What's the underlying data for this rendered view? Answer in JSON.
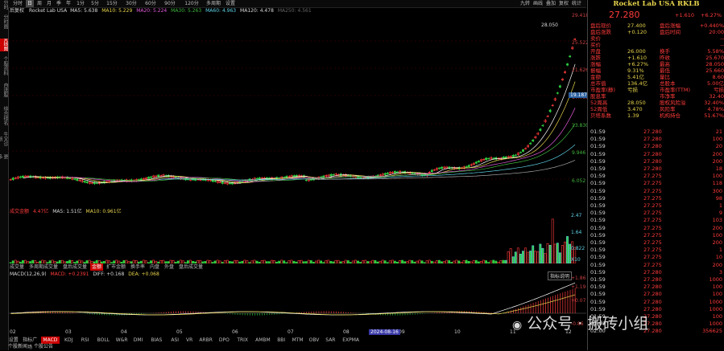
{
  "left_tabs": [
    "分时",
    "分时图",
    "K线图",
    "个股资料",
    "自选股",
    "综合排名",
    "牛叉诊断",
    "更多"
  ],
  "toolbar": {
    "items": [
      "分时",
      "日",
      "周",
      "月",
      "季",
      "年",
      "1分",
      "5分",
      "15分",
      "30分",
      "60分",
      "90分",
      "120分",
      "多周期",
      "设置"
    ],
    "active_index": 1,
    "right_items": [
      "九转",
      "画线",
      "叠加",
      "复权",
      "统计"
    ]
  },
  "main_legend": {
    "title": "后复权",
    "name": "Rocket Lab USA",
    "ma5": "MA5: 5.638",
    "ma10": "MA10: 5.229",
    "ma20": "MA20: 5.224",
    "ma30": "MA30: 5.263",
    "ma60": "MA60: 4.963",
    "ma120": "MA120: 4.478",
    "ma250": "MA250: 4.561"
  },
  "price_axis": [
    "29.418",
    "25.522",
    "21.626",
    "17.730",
    "13.830",
    "9.946",
    "6.052"
  ],
  "current_price_label": "19.187",
  "peak_label": "28.050",
  "volume_legend": {
    "title": "成交金额",
    "value": "4.47亿",
    "ma5": "MA5: 1.51亿",
    "ma10": "MA10: 0.961亿"
  },
  "volume_axis": [
    "2.47",
    "1.64",
    "0.822",
    "X10"
  ],
  "indicator_tabs": [
    "成交量",
    "多周期成交量",
    "盘后成交量",
    "金额",
    "扩市金额",
    "换手率",
    "内盘",
    "外盘",
    "盘后成交量"
  ],
  "indicator_active_index": 3,
  "macd_legend": {
    "title": "MACD(12,26,9)",
    "macd": "MACD: +0.2391",
    "diff": "DIFF: +0.168",
    "dea": "DEA: +0.068"
  },
  "macd_axis": [
    "+1.86",
    "+1.19",
    "+0.07",
    "-0.86"
  ],
  "macd_badge": "指标说明",
  "date_axis": [
    "02",
    "03",
    "04",
    "05",
    "06",
    "07",
    "08",
    "09",
    "10",
    "11",
    "12"
  ],
  "date_highlight": "2024-08-16",
  "bottom_tabs": [
    "设置",
    "指标广场",
    "MACD",
    "KDJ",
    "RSI",
    "BOLL",
    "W&R",
    "DMI",
    "BIAS",
    "ASI",
    "VR",
    "ARBR",
    "DPO",
    "TRIX",
    "AMBM",
    "BBI",
    "MTM",
    "OBV",
    "SAR",
    "EXPMA"
  ],
  "bottom_active_index": 2,
  "bottom_row2": [
    "个股新闻",
    "个股公告"
  ],
  "quote": {
    "title": "Rocket Lab USA RKLB",
    "price": "27.280",
    "change": "+1.610",
    "change_pct": "+6.27%",
    "rows": [
      {
        "k1": "盘后现价",
        "v1": "27.400",
        "k2": "盘后涨幅",
        "v2": "+0.440%"
      },
      {
        "k1": "盘后涨跌",
        "v1": "+0.120",
        "k2": "盘后时间",
        "v2": "20:00"
      },
      {
        "k1": "卖价",
        "v1": "",
        "k2": "",
        "v2": "--"
      },
      {
        "k1": "买价",
        "v1": "",
        "k2": "",
        "v2": "--"
      },
      {
        "k1": "开盘",
        "v1": "26.000",
        "k2": "换手",
        "v2": "5.58%"
      },
      {
        "k1": "涨跌",
        "v1": "+1.610",
        "k2": "昨收",
        "v2": "25.670"
      },
      {
        "k1": "涨幅",
        "v1": "+6.27%",
        "k2": "最高",
        "v2": "28.050"
      },
      {
        "k1": "振幅",
        "v1": "9.31%",
        "k2": "最低",
        "v2": "25.660"
      },
      {
        "k1": "金额",
        "v1": "5.41亿",
        "k2": "量比",
        "v2": "8.60"
      },
      {
        "k1": "总市值",
        "v1": "136.4亿",
        "k2": "总股本",
        "v2": "5.00亿"
      },
      {
        "k1": "市盈率(静)",
        "v1": "亏损",
        "k2": "市盈率(TTM)",
        "v2": "亏损"
      },
      {
        "k1": "股息率",
        "v1": "",
        "k2": "市净率",
        "v2": "32.40"
      },
      {
        "k1": "52周高",
        "v1": "28.050",
        "k2": "股权风险溢",
        "v2": "32.40%"
      },
      {
        "k1": "52周低",
        "v1": "3.470",
        "k2": "风险率",
        "v2": "4.78%"
      },
      {
        "k1": "贝塔系数",
        "v1": "1.39",
        "k2": "机构持仓",
        "v2": "51.67%"
      }
    ]
  },
  "ticks": [
    {
      "t": "01:59",
      "p": "27.280",
      "v": "21"
    },
    {
      "t": "01:59",
      "p": "27.280",
      "v": "100"
    },
    {
      "t": "01:59",
      "p": "27.280",
      "v": "20"
    },
    {
      "t": "01:59",
      "p": "27.280",
      "v": "200"
    },
    {
      "t": "01:59",
      "p": "27.280",
      "v": "200"
    },
    {
      "t": "01:59",
      "p": "27.280",
      "v": "18"
    },
    {
      "t": "01:59",
      "p": "27.275",
      "v": "100"
    },
    {
      "t": "01:59",
      "p": "27.275",
      "v": "118"
    },
    {
      "t": "01:59",
      "p": "27.275",
      "v": "300"
    },
    {
      "t": "01:59",
      "p": "27.275",
      "v": "98"
    },
    {
      "t": "01:59",
      "p": "27.275",
      "v": "1"
    },
    {
      "t": "01:59",
      "p": "27.275",
      "v": "9"
    },
    {
      "t": "01:59",
      "p": "27.275",
      "v": "103"
    },
    {
      "t": "01:59",
      "p": "27.275",
      "v": "200"
    },
    {
      "t": "01:59",
      "p": "27.275",
      "v": "100"
    },
    {
      "t": "01:59",
      "p": "27.275",
      "v": "200"
    },
    {
      "t": "01:59",
      "p": "27.275",
      "v": "1"
    },
    {
      "t": "01:59",
      "p": "27.275",
      "v": "10"
    },
    {
      "t": "01:59",
      "p": "27.275",
      "v": "200"
    },
    {
      "t": "01:59",
      "p": "27.280",
      "v": "3"
    },
    {
      "t": "01:59",
      "p": "27.280",
      "v": "1000"
    },
    {
      "t": "01:59",
      "p": "27.280",
      "v": "100"
    },
    {
      "t": "01:59",
      "p": "27.280",
      "v": "100"
    },
    {
      "t": "01:59",
      "p": "27.280",
      "v": "1000"
    },
    {
      "t": "01:59",
      "p": "27.280",
      "v": "1000"
    },
    {
      "t": "01:59",
      "p": "27.280",
      "v": "100"
    },
    {
      "t": "02:00",
      "p": "27.280",
      "v": "1000"
    },
    {
      "t": "02:00",
      "p": "27.280",
      "v": "356625"
    }
  ],
  "watermark": "公众号 · 搬砖小组",
  "colors": {
    "up": "#ff3b3b",
    "down": "#2ecc40",
    "accent": "#c00000",
    "yellow": "#e8d44d"
  }
}
